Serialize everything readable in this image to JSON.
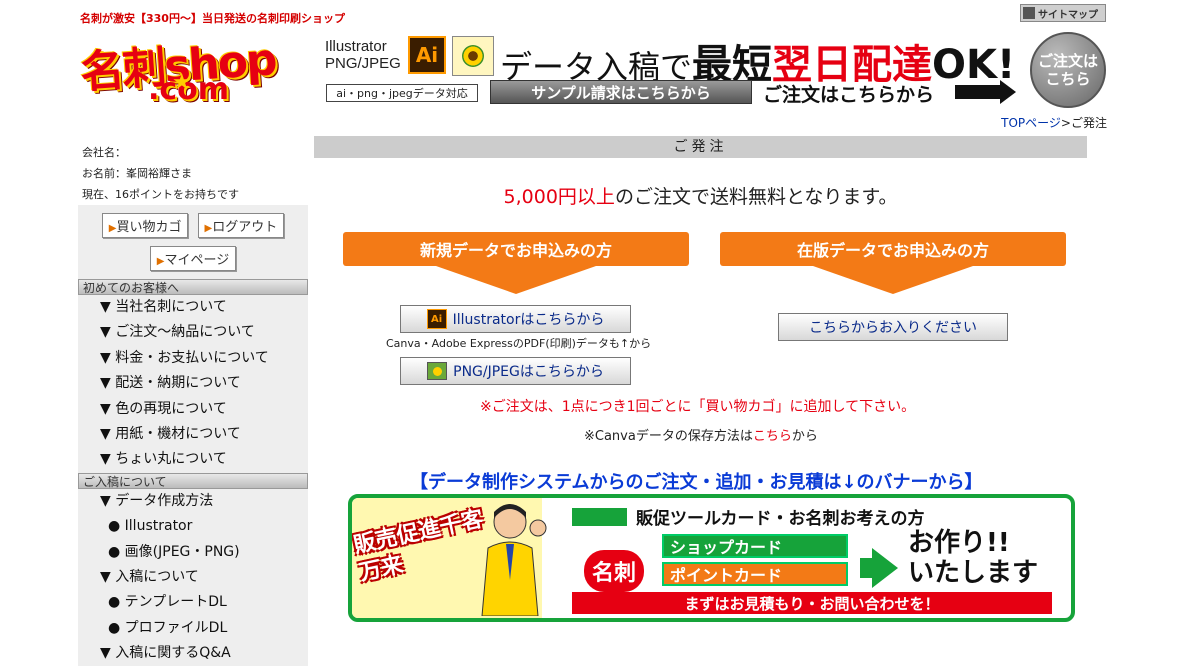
{
  "header": {
    "tagline": "名刺が激安【330円〜】当日発送の名刺印刷ショップ",
    "sitemap_label": "サイトマップ",
    "logo_line1": "名刺shop",
    "logo_line2": ".com",
    "banner": {
      "formats": [
        "Illustrator",
        "PNG/JPEG"
      ],
      "ai_icon_text": "Ai",
      "main_part1": "データ入稿で",
      "main_part2": "最短",
      "main_part3": "翌日配達",
      "main_part4": "OK!",
      "support_label": "ai・png・jpegデータ対応",
      "sample_button": "サンプル請求はこちらから",
      "order_text": "ご注文はこちらから"
    },
    "order_circle_line1": "ご注文は",
    "order_circle_line2": "こちら",
    "breadcrumb_home": "TOPページ",
    "breadcrumb_sep": ">",
    "breadcrumb_current": "ご発注"
  },
  "sidebar": {
    "company_label": "会社名：",
    "name_label": "お名前：峯岡裕輝さま",
    "points_text": "現在、16ポイントをお持ちです",
    "buttons": {
      "cart": "買い物カゴ",
      "logout": "ログアウト",
      "mypage": "マイページ"
    },
    "section1_title": "初めてのお客様へ",
    "section1_items": [
      "▼ 当社名刺について",
      "▼ ご注文〜納品について",
      "▼ 料金・お支払いについて",
      "▼ 配送・納期について",
      "▼ 色の再現について",
      "▼ 用紙・機材について",
      "▼ ちょい丸について"
    ],
    "section2_title": "ご入稿について",
    "section2_items": [
      "▼ データ作成方法",
      "● Illustrator",
      "● 画像(JPEG・PNG)",
      "▼ 入稿について",
      "● テンプレートDL",
      "● プロファイルDL",
      "▼ 入稿に関するQ&A"
    ]
  },
  "main": {
    "title": "ご発注",
    "free_ship_red": "5,000円以上",
    "free_ship_rest": "のご注文で送料無料となります。",
    "new_data_title": "新規データでお申込みの方",
    "stock_data_title": "在版データでお申込みの方",
    "illustrator_button": "Illustratorはこちらから",
    "illustrator_icon_text": "Ai",
    "canva_note": "Canva・Adobe ExpressのPDF(印刷)データも↑から",
    "png_button": "PNG/JPEGはこちらから",
    "stock_button": "こちらからお入りください",
    "cart_note": "※ご注文は、1点につき1回ごとに「買い物カゴ」に追加して下さい。",
    "canva_save_prefix": "※Canvaデータの保存方法は",
    "canva_save_link": "こちら",
    "canva_save_suffix": "から",
    "banner_heading": "【データ制作システムからのご注文・追加・お見積は↓のバナーから】"
  },
  "promo_banner": {
    "promo_text": "販売促進千客万来",
    "top_line": "販促ツールカード・お名刺お考えの方",
    "meishi": "名刺",
    "shop_card": "ショップカード",
    "point_card": "ポイントカード",
    "tsukuri_line1": "お作り!!",
    "tsukuri_line2": "いたします",
    "bottom_line": "まずはお見積もり・お問い合わせを！"
  },
  "colors": {
    "accent_red": "#e60012",
    "orange": "#f37a16",
    "green": "#16a33a",
    "link_blue": "#0a3bd6"
  }
}
